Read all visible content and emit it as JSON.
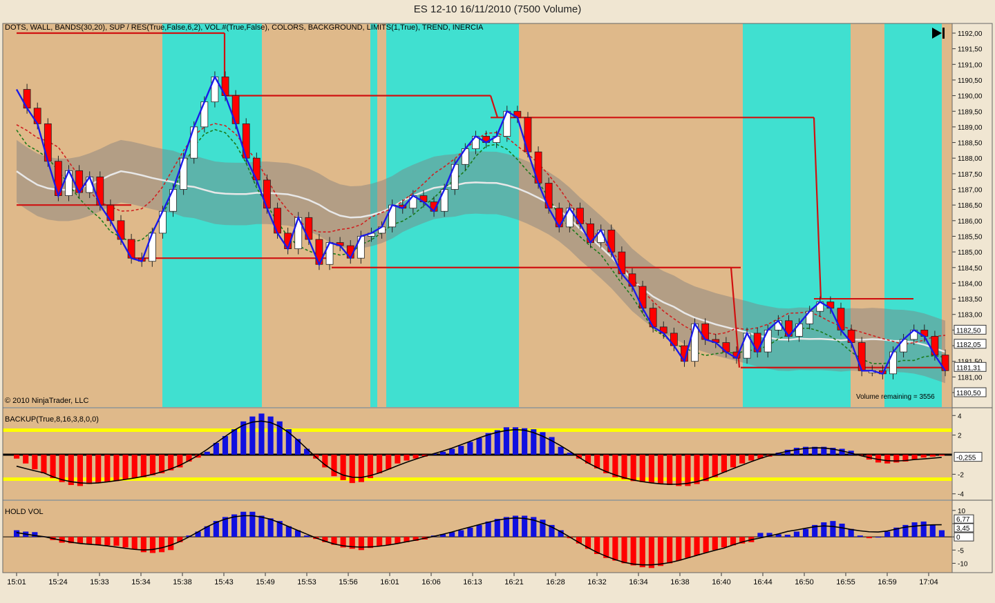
{
  "window": {
    "title": "ES 12-10  16/11/2010 (7500 Volume)"
  },
  "panels": {
    "price": {
      "indicator_label": "DOTS, WALL, BANDS(30,20), SUP / RES(True,False,6,2), VOL.#(True,False), COLORS, BACKGROUND, LIMITS(1,True), TREND, INERCIA",
      "copyright": "© 2010 NinjaTrader, LLC",
      "volume_remaining": "Volume remaining = 3556"
    },
    "backup": {
      "label": "BACKUP(True,8,16,3,8,0,0)",
      "current_value": "-0,255"
    },
    "holdvol": {
      "label": "HOLD VOL",
      "current_values": [
        "6,77",
        "3,45",
        "0"
      ]
    }
  },
  "colors": {
    "bg_tan": "#dfb98a",
    "bg_cyan": "#40e0d0",
    "bull": "#ffffff",
    "bear": "#ff0000",
    "blue": "#1010e0",
    "yellow": "#ffff00",
    "support_resistance": "#d01010",
    "trend_line": "#1a1ae8"
  },
  "chart_data": [
    {
      "type": "candlestick",
      "title": "ES 12-10  16/11/2010 (7500 Volume)",
      "x_tick_labels": [
        "15:01",
        "15:24",
        "15:33",
        "15:34",
        "15:38",
        "15:43",
        "15:49",
        "15:53",
        "15:56",
        "16:01",
        "16:06",
        "16:13",
        "16:21",
        "16:28",
        "16:32",
        "16:34",
        "16:38",
        "16:40",
        "16:44",
        "16:50",
        "16:55",
        "16:59",
        "17:04"
      ],
      "y_tick_labels": [
        "1192,00",
        "1191,50",
        "1191,00",
        "1190,50",
        "1190,00",
        "1189,50",
        "1189,00",
        "1188,50",
        "1188,00",
        "1187,50",
        "1187,00",
        "1186,50",
        "1186,00",
        "1185,50",
        "1185,00",
        "1184,50",
        "1184,00",
        "1183,50",
        "1183,00",
        "1182,50",
        "1182,00",
        "1181,50",
        "1181,00",
        "1180,50"
      ],
      "ylim": [
        1180.4,
        1192.1
      ],
      "price_flags": [
        "1182,50",
        "1182,05",
        "1181,31",
        "1180,50"
      ],
      "close_trend": [
        1190.2,
        1189.6,
        1189.1,
        1187.9,
        1186.8,
        1187.6,
        1186.9,
        1187.4,
        1186.5,
        1186.0,
        1185.4,
        1184.8,
        1184.7,
        1185.6,
        1186.3,
        1187.0,
        1188.0,
        1189.0,
        1189.8,
        1190.6,
        1190.0,
        1189.1,
        1188.0,
        1187.3,
        1186.4,
        1185.6,
        1185.1,
        1186.1,
        1185.4,
        1184.6,
        1185.3,
        1185.2,
        1184.8,
        1185.5,
        1185.6,
        1185.8,
        1186.5,
        1186.4,
        1186.8,
        1186.6,
        1186.3,
        1187.0,
        1187.8,
        1188.3,
        1188.7,
        1188.5,
        1188.7,
        1189.5,
        1189.3,
        1188.2,
        1187.2,
        1186.4,
        1185.8,
        1186.4,
        1185.9,
        1185.3,
        1185.7,
        1185.0,
        1184.3,
        1183.9,
        1183.2,
        1182.6,
        1182.4,
        1182.0,
        1181.5,
        1182.7,
        1182.2,
        1182.1,
        1181.8,
        1181.6,
        1182.4,
        1181.8,
        1182.5,
        1182.8,
        1182.3,
        1182.7,
        1183.1,
        1183.4,
        1183.2,
        1182.5,
        1182.1,
        1181.2,
        1181.2,
        1181.1,
        1181.8,
        1182.2,
        1182.5,
        1182.3,
        1181.7,
        1181.2
      ],
      "support_resistance_levels": [
        1192.0,
        1190.0,
        1189.3,
        1186.5,
        1185.0,
        1184.5,
        1183.5,
        1181.3,
        1181.0,
        1182.9
      ]
    },
    {
      "type": "bar",
      "title": "BACKUP(True,8,16,3,8,0,0)",
      "ylim": [
        -4.3,
        4.3
      ],
      "y_tick_labels": [
        "4",
        "2",
        "-2",
        "-4"
      ],
      "reference_levels": [
        2.5,
        -2.5
      ],
      "values": [
        -0.4,
        -0.9,
        -1.5,
        -1.9,
        -2.4,
        -2.8,
        -3.1,
        -3.2,
        -3.0,
        -2.9,
        -2.8,
        -2.7,
        -2.5,
        -2.4,
        -2.3,
        -2.1,
        -1.9,
        -1.6,
        -1.3,
        -0.7,
        -0.3,
        0.3,
        1.2,
        1.9,
        2.6,
        3.4,
        3.9,
        4.2,
        3.9,
        3.4,
        2.6,
        1.6,
        0.6,
        -0.4,
        -1.3,
        -2.2,
        -2.6,
        -2.9,
        -2.8,
        -2.4,
        -1.9,
        -1.5,
        -0.9,
        -0.6,
        -0.4,
        -0.2,
        0.1,
        0.3,
        0.6,
        0.9,
        1.3,
        1.7,
        2.2,
        2.5,
        2.8,
        2.8,
        2.7,
        2.6,
        2.3,
        1.8,
        0.8,
        0.2,
        -0.4,
        -0.9,
        -1.4,
        -1.9,
        -2.3,
        -2.5,
        -2.7,
        -2.8,
        -2.9,
        -3.0,
        -3.1,
        -3.2,
        -3.2,
        -3.0,
        -2.7,
        -2.3,
        -1.8,
        -1.3,
        -0.9,
        -0.6,
        -0.4,
        -0.2,
        0.2,
        0.5,
        0.7,
        0.8,
        0.8,
        0.8,
        0.7,
        0.6,
        0.4,
        -0.1,
        -0.5,
        -0.8,
        -0.9,
        -0.8,
        -0.7,
        -0.5,
        -0.3,
        -0.2,
        -0.1
      ]
    },
    {
      "type": "bar",
      "title": "HOLD VOL",
      "ylim": [
        -12.5,
        11
      ],
      "y_tick_labels": [
        "10",
        "5",
        "0",
        "-5",
        "-10"
      ],
      "values": [
        2.5,
        2.0,
        1.8,
        0.2,
        -1.2,
        -2.2,
        -2.4,
        -2.6,
        -2.8,
        -3.0,
        -3.2,
        -3.4,
        -4.0,
        -4.8,
        -5.8,
        -6.1,
        -5.8,
        -5.0,
        -2.0,
        0.5,
        2.0,
        4.0,
        6.0,
        7.5,
        8.5,
        9.5,
        9.5,
        8.0,
        7.0,
        6.0,
        4.0,
        2.5,
        0.5,
        -0.8,
        -2.0,
        -3.0,
        -4.0,
        -4.5,
        -5.0,
        -4.2,
        -3.5,
        -3.0,
        -2.5,
        -2.0,
        -1.5,
        -1.0,
        0.5,
        1.0,
        1.8,
        2.5,
        3.5,
        4.5,
        5.8,
        6.8,
        7.5,
        8.0,
        8.0,
        7.5,
        6.5,
        4.5,
        2.5,
        -0.5,
        -2.5,
        -4.5,
        -6.5,
        -8.0,
        -9.0,
        -10.0,
        -10.8,
        -11.5,
        -11.8,
        -11.0,
        -10.0,
        -9.0,
        -8.0,
        -7.0,
        -6.0,
        -5.0,
        -4.0,
        -3.2,
        -2.5,
        -2.0,
        1.5,
        1.5,
        1.0,
        0.8,
        2.0,
        3.0,
        4.5,
        5.5,
        6.0,
        5.0,
        3.0,
        0.5,
        -0.5,
        0.0,
        2.0,
        3.5,
        4.5,
        5.5,
        5.8,
        4.5,
        2.5
      ]
    }
  ]
}
